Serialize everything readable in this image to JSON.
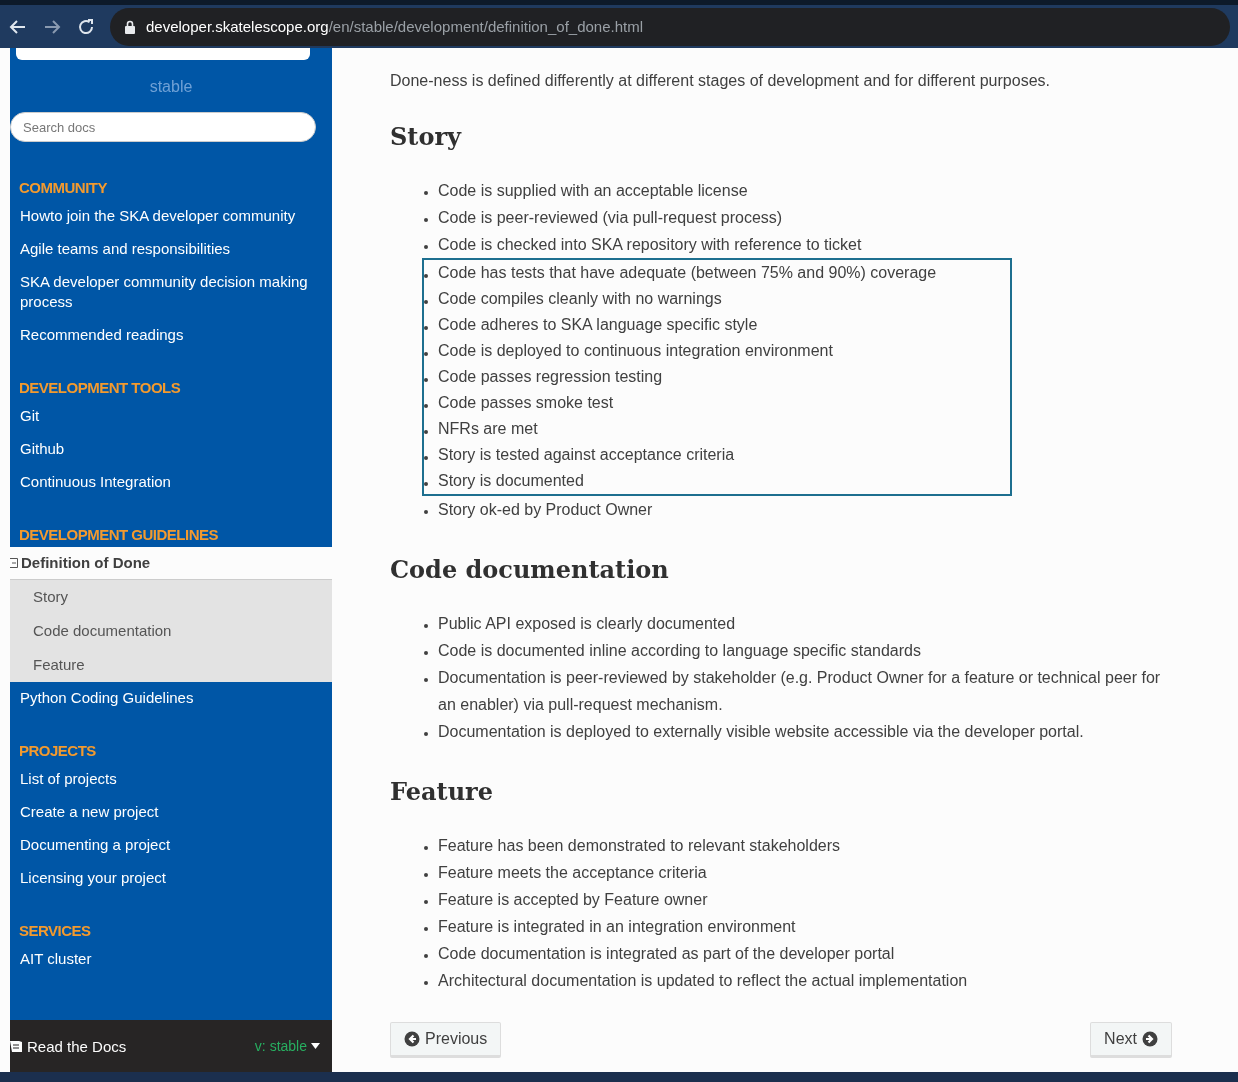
{
  "browser": {
    "url_host": "developer.skatelescope.org",
    "url_path": "/en/stable/development/definition_of_done.html"
  },
  "sidebar": {
    "version": "stable",
    "search": {
      "placeholder": "Search docs"
    },
    "sections": [
      {
        "caption": "COMMUNITY",
        "items": [
          {
            "label": "Howto join the SKA developer community",
            "current": false
          },
          {
            "label": "Agile teams and responsibilities",
            "current": false
          },
          {
            "label": "SKA developer community decision making process",
            "current": false
          },
          {
            "label": "Recommended readings",
            "current": false
          }
        ]
      },
      {
        "caption": "DEVELOPMENT TOOLS",
        "items": [
          {
            "label": "Git",
            "current": false
          },
          {
            "label": "Github",
            "current": false
          },
          {
            "label": "Continuous Integration",
            "current": false
          }
        ]
      },
      {
        "caption": "DEVELOPMENT GUIDELINES",
        "items": [
          {
            "label": "Definition of Done",
            "current": true,
            "expanded": true,
            "children": [
              {
                "label": "Story"
              },
              {
                "label": "Code documentation"
              },
              {
                "label": "Feature"
              }
            ]
          },
          {
            "label": "Python Coding Guidelines",
            "current": false
          }
        ]
      },
      {
        "caption": "PROJECTS",
        "items": [
          {
            "label": "List of projects",
            "current": false
          },
          {
            "label": "Create a new project",
            "current": false
          },
          {
            "label": "Documenting a project",
            "current": false
          },
          {
            "label": "Licensing your project",
            "current": false
          }
        ]
      },
      {
        "caption": "SERVICES",
        "items": [
          {
            "label": "AIT cluster",
            "current": false
          }
        ]
      }
    ],
    "footer": {
      "label": "Read the Docs",
      "version": "v: stable"
    }
  },
  "content": {
    "intro": "Done-ness is defined differently at different stages of development and for different purposes.",
    "sections": [
      {
        "title": "Story",
        "items": [
          {
            "text": "Code is supplied with an acceptable license",
            "highlighted": false
          },
          {
            "text": "Code is peer-reviewed (via pull-request process)",
            "highlighted": false
          },
          {
            "text": "Code is checked into SKA repository with reference to ticket",
            "highlighted": false
          },
          {
            "text": "Code has tests that have adequate (between 75% and 90%) coverage",
            "highlighted": true
          },
          {
            "text": "Code compiles cleanly with no warnings",
            "highlighted": true
          },
          {
            "text": "Code adheres to SKA language specific style",
            "highlighted": true
          },
          {
            "text": "Code is deployed to continuous integration environment",
            "highlighted": true
          },
          {
            "text": "Code passes regression testing",
            "highlighted": true
          },
          {
            "text": "Code passes smoke test",
            "highlighted": true
          },
          {
            "text": "NFRs are met",
            "highlighted": true
          },
          {
            "text": "Story is tested against acceptance criteria",
            "highlighted": true
          },
          {
            "text": "Story is documented",
            "highlighted": true
          },
          {
            "text": "Story ok-ed by Product Owner",
            "highlighted": false
          }
        ]
      },
      {
        "title": "Code documentation",
        "items": [
          {
            "text": "Public API exposed is clearly documented",
            "highlighted": false
          },
          {
            "text": "Code is documented inline according to language specific standards",
            "highlighted": false
          },
          {
            "text": "Documentation is peer-reviewed by stakeholder (e.g. Product Owner for a feature or technical peer for an enabler) via pull-request mechanism.",
            "highlighted": false
          },
          {
            "text": "Documentation is deployed to externally visible website accessible via the developer portal.",
            "highlighted": false
          }
        ]
      },
      {
        "title": "Feature",
        "items": [
          {
            "text": "Feature has been demonstrated to relevant stakeholders",
            "highlighted": false
          },
          {
            "text": "Feature meets the acceptance criteria",
            "highlighted": false
          },
          {
            "text": "Feature is accepted by Feature owner",
            "highlighted": false
          },
          {
            "text": "Feature is integrated in an integration environment",
            "highlighted": false
          },
          {
            "text": "Code documentation is integrated as part of the developer portal",
            "highlighted": false
          },
          {
            "text": "Architectural documentation is updated to reflect the actual implementation",
            "highlighted": false
          }
        ]
      }
    ],
    "nav": {
      "previous": "Previous",
      "next": "Next"
    }
  }
}
